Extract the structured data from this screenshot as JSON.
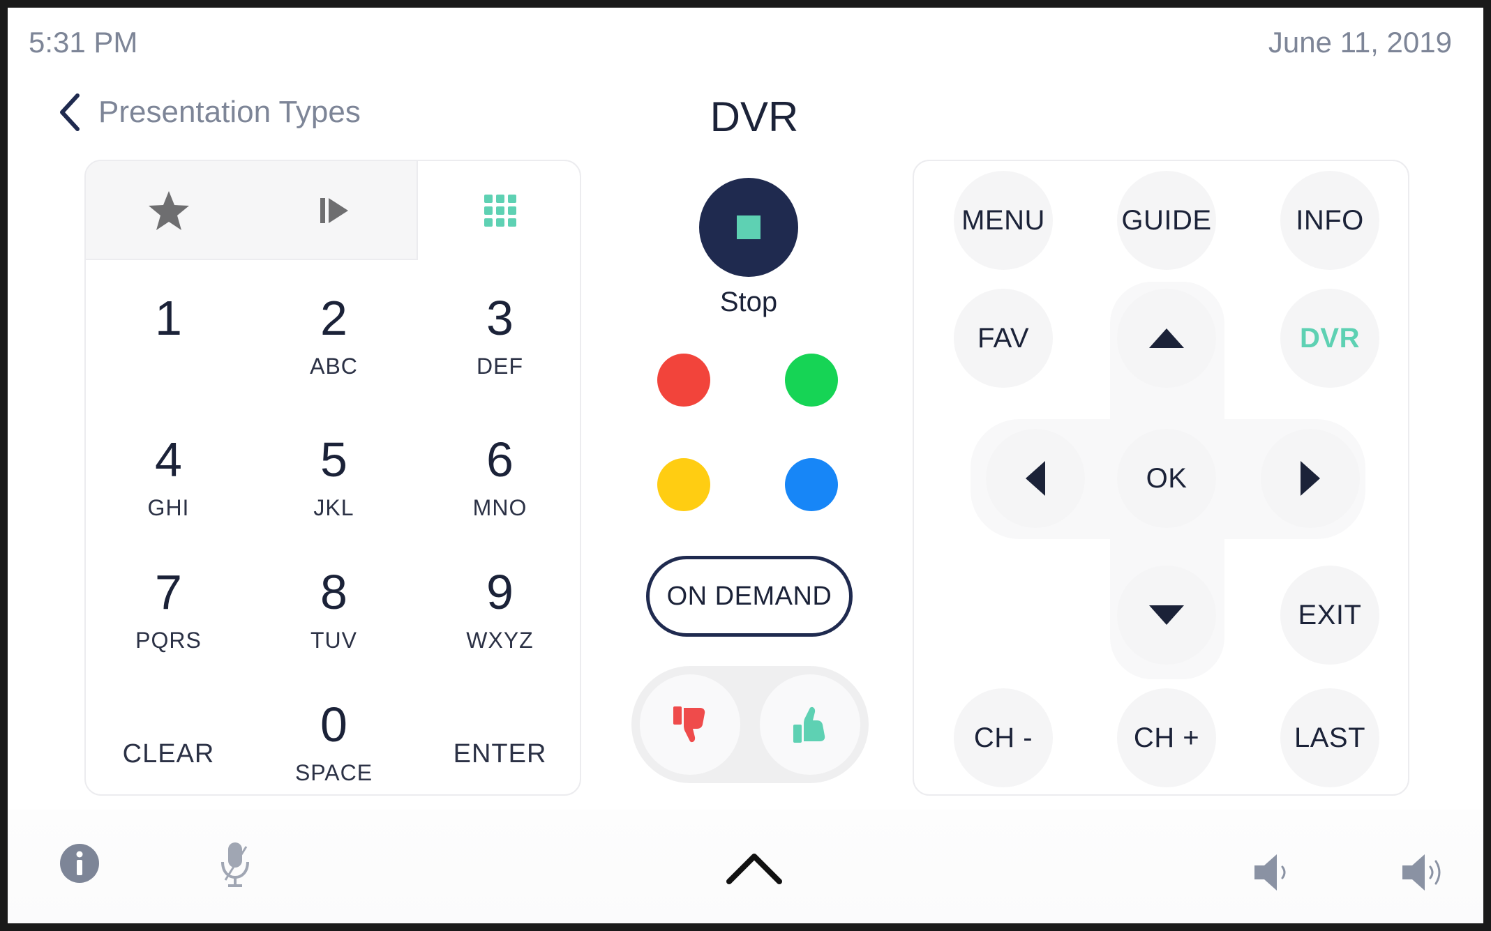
{
  "status": {
    "time": "5:31 PM",
    "date": "June 11, 2019"
  },
  "nav": {
    "back_label": "Presentation Types",
    "title": "DVR"
  },
  "keypad": {
    "tabs": [
      {
        "name": "favorites",
        "icon": "star-icon"
      },
      {
        "name": "playback",
        "icon": "play-step-icon"
      },
      {
        "name": "keypad",
        "icon": "grid-icon",
        "active": true
      }
    ],
    "keys": [
      {
        "num": "1",
        "sub": ""
      },
      {
        "num": "2",
        "sub": "ABC"
      },
      {
        "num": "3",
        "sub": "DEF"
      },
      {
        "num": "4",
        "sub": "GHI"
      },
      {
        "num": "5",
        "sub": "JKL"
      },
      {
        "num": "6",
        "sub": "MNO"
      },
      {
        "num": "7",
        "sub": "PQRS"
      },
      {
        "num": "8",
        "sub": "TUV"
      },
      {
        "num": "9",
        "sub": "WXYZ"
      },
      {
        "num": "0",
        "sub": "SPACE"
      }
    ],
    "clear_label": "CLEAR",
    "enter_label": "ENTER"
  },
  "transport": {
    "stop_label": "Stop"
  },
  "color_buttons": [
    {
      "name": "red",
      "color": "#f2443b"
    },
    {
      "name": "green",
      "color": "#16d455"
    },
    {
      "name": "yellow",
      "color": "#ffcd12"
    },
    {
      "name": "blue",
      "color": "#1786f7"
    }
  ],
  "on_demand_label": "ON DEMAND",
  "rating": {
    "down_icon": "thumbs-down-icon",
    "up_icon": "thumbs-up-icon",
    "down_color": "#ef4b4b",
    "up_color": "#5ed1b3"
  },
  "remote": {
    "menu": "MENU",
    "guide": "GUIDE",
    "info": "INFO",
    "fav": "FAV",
    "dvr": "DVR",
    "ok": "OK",
    "exit": "EXIT",
    "ch_down": "CH -",
    "ch_up": "CH +",
    "last": "LAST"
  },
  "colors": {
    "accent": "#5ed1b3",
    "navy": "#1f2a4f",
    "muted": "#7d8597"
  }
}
